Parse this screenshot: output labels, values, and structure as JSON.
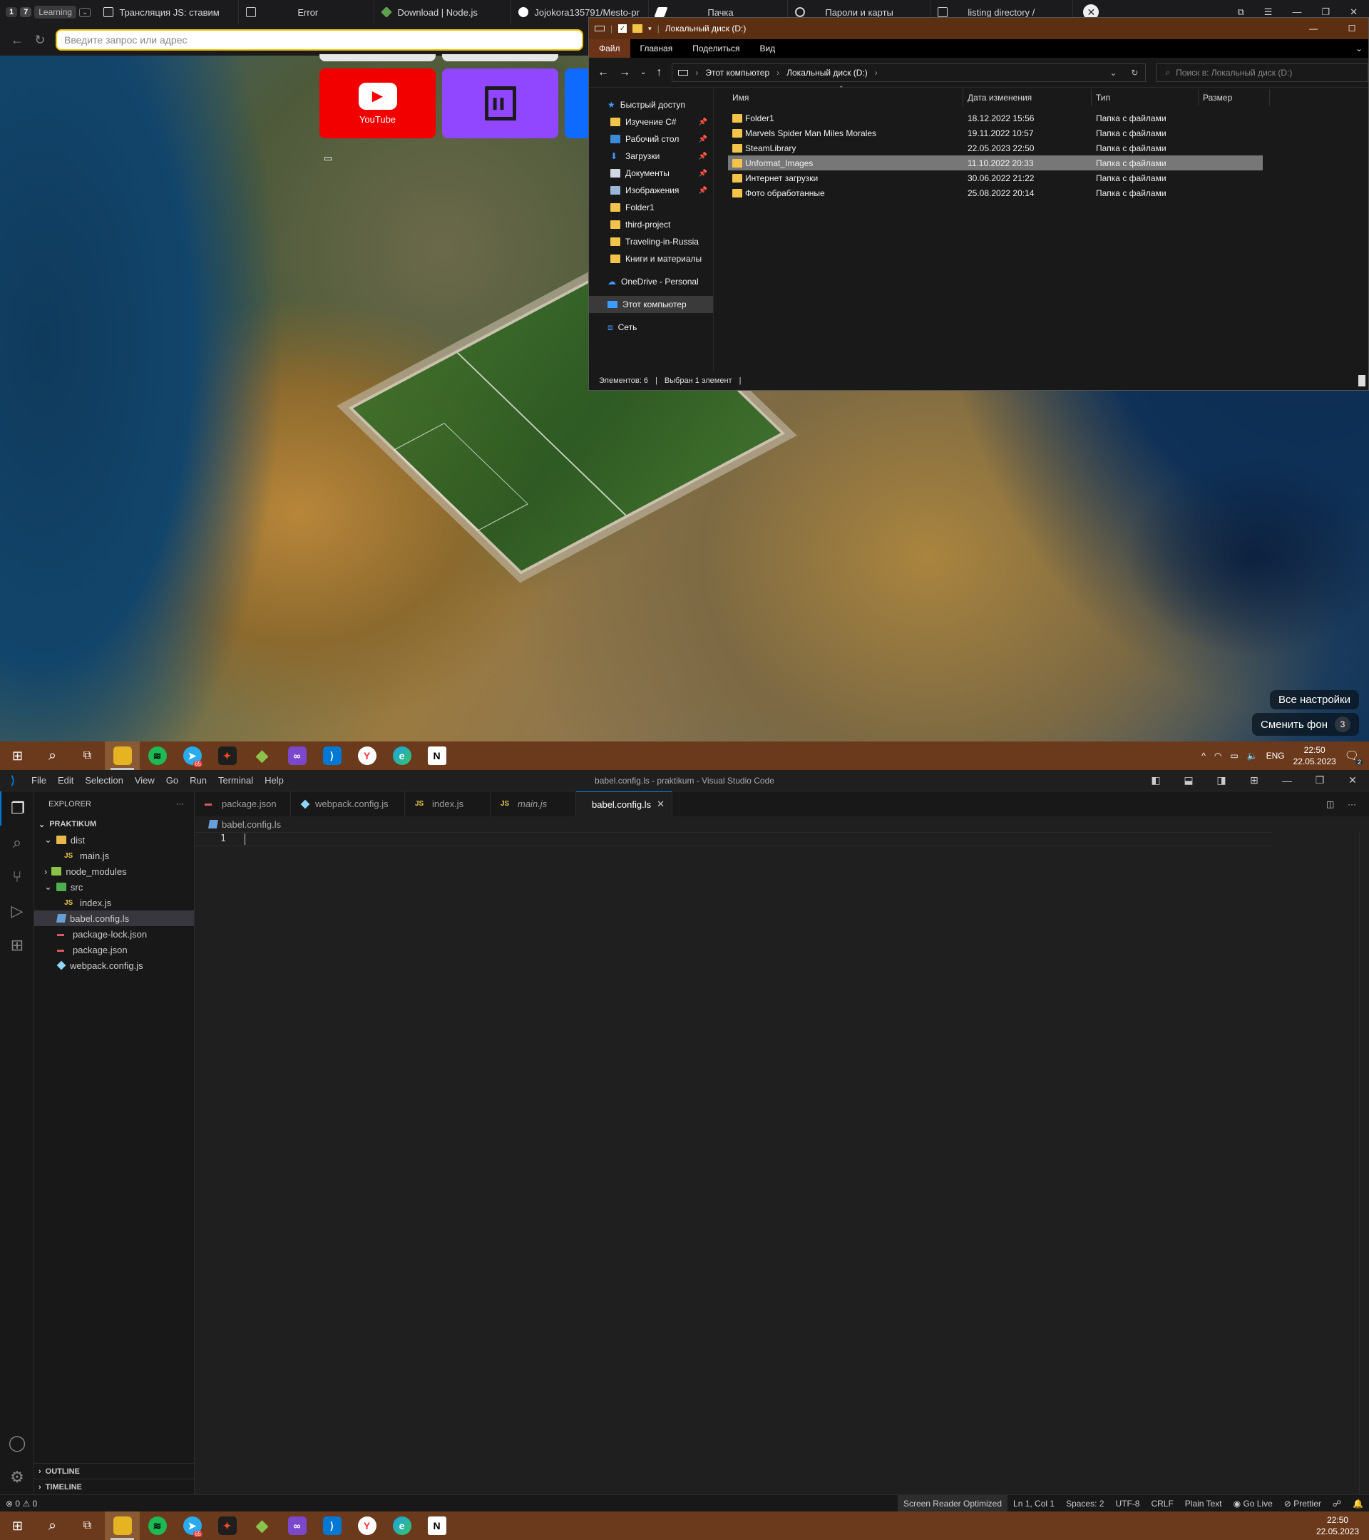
{
  "browser": {
    "group_num": "1",
    "group_count": "7",
    "group_label": "Learning",
    "tabs": [
      {
        "title": "Трансляция JS: ставим",
        "icon": "notion-icon",
        "color": "#dddddd"
      },
      {
        "title": "Error",
        "icon": "page-icon",
        "color": "#cccccc"
      },
      {
        "title": "Download | Node.js",
        "icon": "nodejs-icon",
        "color": "#5fa04e"
      },
      {
        "title": "Jojokora135791/Mesto-pr",
        "icon": "github-icon",
        "color": "#ffffff"
      },
      {
        "title": "Пачка",
        "icon": "pachka-icon",
        "color": "#ffffff"
      },
      {
        "title": "Пароли и карты",
        "icon": "key-icon",
        "color": "#cccccc"
      },
      {
        "title": "listing directory /",
        "icon": "page-icon",
        "color": "#cccccc"
      }
    ],
    "address_placeholder": "Введите запрос или адрес",
    "tiles": [
      {
        "label": "YouTube",
        "color": "#ff0000"
      },
      {
        "label": "",
        "color": "#9146ff"
      }
    ],
    "all_settings": "Все настройки",
    "change_bg": "Сменить фон",
    "change_bg_count": "3"
  },
  "explorer": {
    "title": "Локальный диск (D:)",
    "ribbon": [
      "Файл",
      "Главная",
      "Поделиться",
      "Вид"
    ],
    "path": [
      "Этот компьютер",
      "Локальный диск (D:)"
    ],
    "search_placeholder": "Поиск в: Локальный диск (D:)",
    "nav": {
      "quick_access": "Быстрый доступ",
      "pinned": [
        "Изучение C#",
        "Рабочий стол",
        "Загрузки",
        "Документы",
        "Изображения"
      ],
      "folders": [
        "Folder1",
        "third-project",
        "Traveling-in-Russia",
        "Книги и материалы"
      ],
      "onedrive": "OneDrive - Personal",
      "this_pc": "Этот компьютер",
      "network": "Сеть"
    },
    "columns": [
      "Имя",
      "Дата изменения",
      "Тип",
      "Размер"
    ],
    "rows": [
      {
        "name": "Folder1",
        "date": "18.12.2022 15:56",
        "type": "Папка с файлами"
      },
      {
        "name": "Marvels Spider Man Miles Morales",
        "date": "19.11.2022 10:57",
        "type": "Папка с файлами"
      },
      {
        "name": "SteamLibrary",
        "date": "22.05.2023 22:50",
        "type": "Папка с файлами"
      },
      {
        "name": "Unformat_Images",
        "date": "11.10.2022 20:33",
        "type": "Папка с файлами"
      },
      {
        "name": "Интернет загрузки",
        "date": "30.06.2022 21:22",
        "type": "Папка с файлами"
      },
      {
        "name": "Фото обработанные",
        "date": "25.08.2022 20:14",
        "type": "Папка с файлами"
      }
    ],
    "selected_row": 3,
    "status_items": "Элементов: 6",
    "status_selected": "Выбран 1 элемент"
  },
  "taskbar": {
    "apps": [
      {
        "name": "explorer",
        "glyph": "▬",
        "color": "#e6b422"
      },
      {
        "name": "spotify",
        "glyph": "≋",
        "color": "#1db954"
      },
      {
        "name": "telegram",
        "glyph": "➤",
        "color": "#2aabee",
        "badge": "65"
      },
      {
        "name": "figma",
        "glyph": "✦",
        "color": "#a259ff"
      },
      {
        "name": "git-client",
        "glyph": "◆",
        "color": "#8bc34a"
      },
      {
        "name": "visual-studio",
        "glyph": "∞",
        "color": "#7b47cc"
      },
      {
        "name": "vscode",
        "glyph": "⟩",
        "color": "#0078d4"
      },
      {
        "name": "yandex-browser",
        "glyph": "Y",
        "color": "#f33"
      },
      {
        "name": "edge",
        "glyph": "e",
        "color": "#1ba1e2"
      },
      {
        "name": "notion",
        "glyph": "N",
        "color": "#fff"
      }
    ],
    "lang": "ENG",
    "time": "22:50",
    "date": "22.05.2023",
    "notif_count": "2"
  },
  "vscode": {
    "title": "babel.config.ls - praktikum - Visual Studio Code",
    "menu": [
      "File",
      "Edit",
      "Selection",
      "View",
      "Go",
      "Run",
      "Terminal",
      "Help"
    ],
    "explorer_title": "EXPLORER",
    "project": "PRAKTIKUM",
    "tree": [
      {
        "label": "dist",
        "kind": "folder-open",
        "depth": 1
      },
      {
        "label": "main.js",
        "kind": "js",
        "depth": 2
      },
      {
        "label": "node_modules",
        "kind": "folder",
        "depth": 1
      },
      {
        "label": "src",
        "kind": "folder-open",
        "depth": 1
      },
      {
        "label": "index.js",
        "kind": "js",
        "depth": 2
      },
      {
        "label": "babel.config.ls",
        "kind": "babel",
        "depth": 1
      },
      {
        "label": "package-lock.json",
        "kind": "json",
        "depth": 1
      },
      {
        "label": "package.json",
        "kind": "json",
        "depth": 1
      },
      {
        "label": "webpack.config.js",
        "kind": "webpack",
        "depth": 1
      }
    ],
    "selected_tree": 5,
    "outline": "OUTLINE",
    "timeline": "TIMELINE",
    "tabs": [
      {
        "label": "package.json",
        "kind": "json"
      },
      {
        "label": "webpack.config.js",
        "kind": "webpack"
      },
      {
        "label": "index.js",
        "kind": "js"
      },
      {
        "label": "main.js",
        "kind": "js",
        "italic": true
      },
      {
        "label": "babel.config.ls",
        "kind": "babel",
        "active": true
      }
    ],
    "breadcrumb": "babel.config.ls",
    "line_number": "1",
    "status": {
      "errors": "0",
      "warnings": "0",
      "screen_reader": "Screen Reader Optimized",
      "position": "Ln 1, Col 1",
      "spaces": "Spaces: 2",
      "encoding": "UTF-8",
      "eol": "CRLF",
      "language": "Plain Text",
      "golive": "Go Live",
      "prettier": "Prettier"
    }
  }
}
